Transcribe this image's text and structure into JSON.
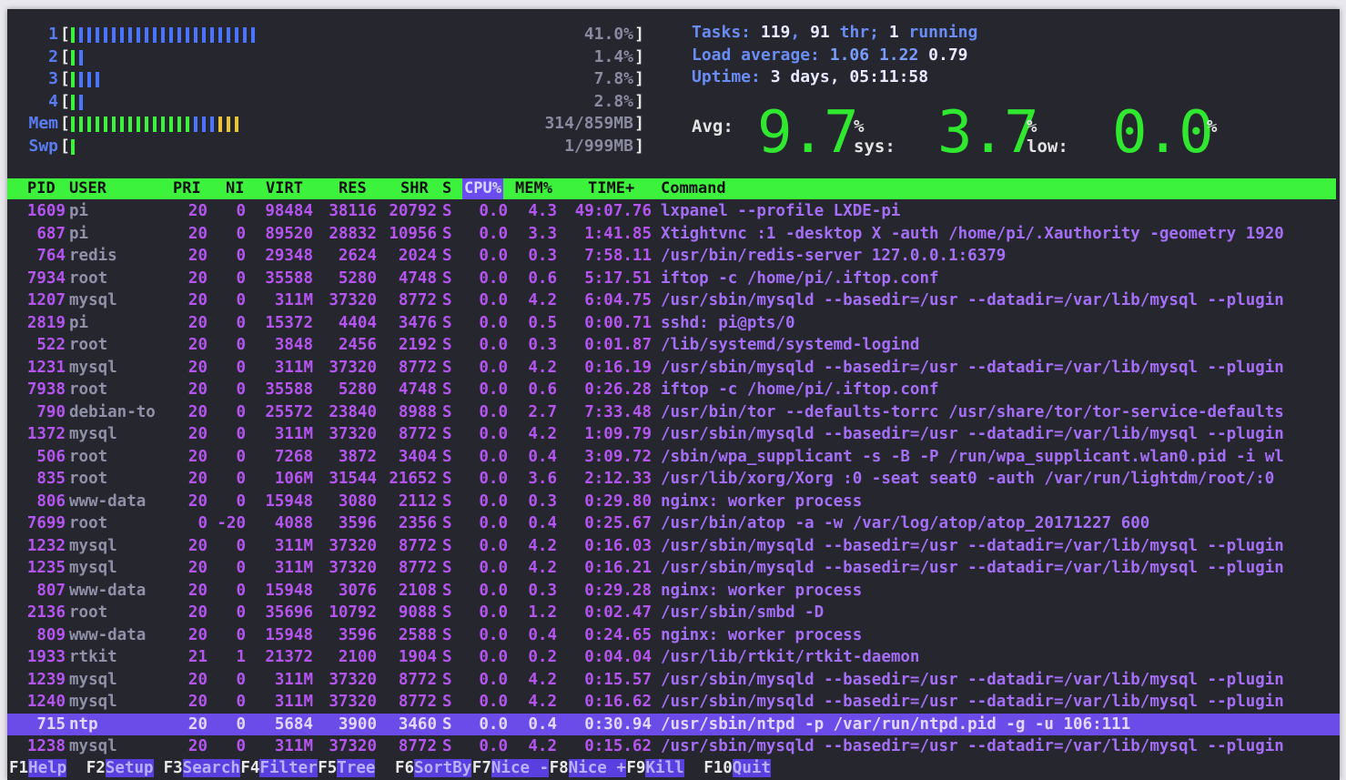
{
  "colors": {
    "terminal_bg": "#26262e",
    "header_bar": "#3df23d",
    "sorted_column": "#6a4cf0",
    "selected_row": "#6b4ce8",
    "process_text": "#b455f0",
    "meter_green": "#3df23d",
    "meter_blue": "#4a74ff",
    "meter_yellow": "#e8c43a"
  },
  "meters": {
    "cpu": [
      {
        "label": "1",
        "value": "41.0%",
        "percent": 0.41
      },
      {
        "label": "2",
        "value": "1.4%",
        "percent": 0.014
      },
      {
        "label": "3",
        "value": "7.8%",
        "percent": 0.078
      },
      {
        "label": "4",
        "value": "2.8%",
        "percent": 0.028
      }
    ],
    "mem": {
      "label": "Mem",
      "value": "314/859MB",
      "percent": 0.366
    },
    "swp": {
      "label": "Swp",
      "value": "1/999MB",
      "percent": 0.001
    }
  },
  "info": {
    "tasks_label": "Tasks:",
    "tasks_count": "119",
    "threads_count": "91",
    "threads_label": "thr;",
    "running_count": "1",
    "running_label": "running",
    "load_label": "Load average:",
    "load_1": "1.06",
    "load_5": "1.22",
    "load_15": "0.79",
    "uptime_label": "Uptime:",
    "uptime_value": "3 days, 05:11:58"
  },
  "avg_meter": {
    "avg_label": "Avg:",
    "avg_value": "9.7",
    "sys_label": "% sys:",
    "sys_value": "3.7",
    "low_label": "% low:",
    "low_value": "0.0",
    "end_label": "%"
  },
  "columns": [
    "PID",
    "USER",
    "PRI",
    "NI",
    "VIRT",
    "RES",
    "SHR",
    "S",
    "CPU%",
    "MEM%",
    "TIME+",
    "Command"
  ],
  "processes": [
    {
      "pid": "1609",
      "user": "pi",
      "pri": "20",
      "ni": "0",
      "virt": "98484",
      "res": "38116",
      "shr": "20792",
      "s": "S",
      "cpu": "0.0",
      "mem": "4.3",
      "time": "49:07.76",
      "cmd": "lxpanel --profile LXDE-pi"
    },
    {
      "pid": "687",
      "user": "pi",
      "pri": "20",
      "ni": "0",
      "virt": "89520",
      "res": "28832",
      "shr": "10956",
      "s": "S",
      "cpu": "0.0",
      "mem": "3.3",
      "time": "1:41.85",
      "cmd": "Xtightvnc :1 -desktop X -auth /home/pi/.Xauthority -geometry 1920"
    },
    {
      "pid": "764",
      "user": "redis",
      "pri": "20",
      "ni": "0",
      "virt": "29348",
      "res": "2624",
      "shr": "2024",
      "s": "S",
      "cpu": "0.0",
      "mem": "0.3",
      "time": "7:58.11",
      "cmd": "/usr/bin/redis-server 127.0.0.1:6379"
    },
    {
      "pid": "7934",
      "user": "root",
      "pri": "20",
      "ni": "0",
      "virt": "35588",
      "res": "5280",
      "shr": "4748",
      "s": "S",
      "cpu": "0.0",
      "mem": "0.6",
      "time": "5:17.51",
      "cmd": "iftop -c /home/pi/.iftop.conf"
    },
    {
      "pid": "1207",
      "user": "mysql",
      "pri": "20",
      "ni": "0",
      "virt": "311M",
      "res": "37320",
      "shr": "8772",
      "s": "S",
      "cpu": "0.0",
      "mem": "4.2",
      "time": "6:04.75",
      "cmd": "/usr/sbin/mysqld --basedir=/usr --datadir=/var/lib/mysql --plugin"
    },
    {
      "pid": "2819",
      "user": "pi",
      "pri": "20",
      "ni": "0",
      "virt": "15372",
      "res": "4404",
      "shr": "3476",
      "s": "S",
      "cpu": "0.0",
      "mem": "0.5",
      "time": "0:00.71",
      "cmd": "sshd: pi@pts/0"
    },
    {
      "pid": "522",
      "user": "root",
      "pri": "20",
      "ni": "0",
      "virt": "3848",
      "res": "2456",
      "shr": "2192",
      "s": "S",
      "cpu": "0.0",
      "mem": "0.3",
      "time": "0:01.87",
      "cmd": "/lib/systemd/systemd-logind"
    },
    {
      "pid": "1231",
      "user": "mysql",
      "pri": "20",
      "ni": "0",
      "virt": "311M",
      "res": "37320",
      "shr": "8772",
      "s": "S",
      "cpu": "0.0",
      "mem": "4.2",
      "time": "0:16.19",
      "cmd": "/usr/sbin/mysqld --basedir=/usr --datadir=/var/lib/mysql --plugin"
    },
    {
      "pid": "7938",
      "user": "root",
      "pri": "20",
      "ni": "0",
      "virt": "35588",
      "res": "5280",
      "shr": "4748",
      "s": "S",
      "cpu": "0.0",
      "mem": "0.6",
      "time": "0:26.28",
      "cmd": "iftop -c /home/pi/.iftop.conf"
    },
    {
      "pid": "790",
      "user": "debian-to",
      "pri": "20",
      "ni": "0",
      "virt": "25572",
      "res": "23840",
      "shr": "8988",
      "s": "S",
      "cpu": "0.0",
      "mem": "2.7",
      "time": "7:33.48",
      "cmd": "/usr/bin/tor --defaults-torrc /usr/share/tor/tor-service-defaults"
    },
    {
      "pid": "1372",
      "user": "mysql",
      "pri": "20",
      "ni": "0",
      "virt": "311M",
      "res": "37320",
      "shr": "8772",
      "s": "S",
      "cpu": "0.0",
      "mem": "4.2",
      "time": "1:09.79",
      "cmd": "/usr/sbin/mysqld --basedir=/usr --datadir=/var/lib/mysql --plugin"
    },
    {
      "pid": "506",
      "user": "root",
      "pri": "20",
      "ni": "0",
      "virt": "7268",
      "res": "3872",
      "shr": "3404",
      "s": "S",
      "cpu": "0.0",
      "mem": "0.4",
      "time": "3:09.72",
      "cmd": "/sbin/wpa_supplicant -s -B -P /run/wpa_supplicant.wlan0.pid -i wl"
    },
    {
      "pid": "835",
      "user": "root",
      "pri": "20",
      "ni": "0",
      "virt": "106M",
      "res": "31544",
      "shr": "21652",
      "s": "S",
      "cpu": "0.0",
      "mem": "3.6",
      "time": "2:12.33",
      "cmd": "/usr/lib/xorg/Xorg :0 -seat seat0 -auth /var/run/lightdm/root/:0"
    },
    {
      "pid": "806",
      "user": "www-data",
      "pri": "20",
      "ni": "0",
      "virt": "15948",
      "res": "3080",
      "shr": "2112",
      "s": "S",
      "cpu": "0.0",
      "mem": "0.3",
      "time": "0:29.80",
      "cmd": "nginx: worker process"
    },
    {
      "pid": "7699",
      "user": "root",
      "pri": "0",
      "ni": "-20",
      "virt": "4088",
      "res": "3596",
      "shr": "2356",
      "s": "S",
      "cpu": "0.0",
      "mem": "0.4",
      "time": "0:25.67",
      "cmd": "/usr/bin/atop -a -w /var/log/atop/atop_20171227 600"
    },
    {
      "pid": "1232",
      "user": "mysql",
      "pri": "20",
      "ni": "0",
      "virt": "311M",
      "res": "37320",
      "shr": "8772",
      "s": "S",
      "cpu": "0.0",
      "mem": "4.2",
      "time": "0:16.03",
      "cmd": "/usr/sbin/mysqld --basedir=/usr --datadir=/var/lib/mysql --plugin"
    },
    {
      "pid": "1235",
      "user": "mysql",
      "pri": "20",
      "ni": "0",
      "virt": "311M",
      "res": "37320",
      "shr": "8772",
      "s": "S",
      "cpu": "0.0",
      "mem": "4.2",
      "time": "0:16.21",
      "cmd": "/usr/sbin/mysqld --basedir=/usr --datadir=/var/lib/mysql --plugin"
    },
    {
      "pid": "807",
      "user": "www-data",
      "pri": "20",
      "ni": "0",
      "virt": "15948",
      "res": "3076",
      "shr": "2108",
      "s": "S",
      "cpu": "0.0",
      "mem": "0.3",
      "time": "0:29.28",
      "cmd": "nginx: worker process"
    },
    {
      "pid": "2136",
      "user": "root",
      "pri": "20",
      "ni": "0",
      "virt": "35696",
      "res": "10792",
      "shr": "9088",
      "s": "S",
      "cpu": "0.0",
      "mem": "1.2",
      "time": "0:02.47",
      "cmd": "/usr/sbin/smbd -D"
    },
    {
      "pid": "809",
      "user": "www-data",
      "pri": "20",
      "ni": "0",
      "virt": "15948",
      "res": "3596",
      "shr": "2588",
      "s": "S",
      "cpu": "0.0",
      "mem": "0.4",
      "time": "0:24.65",
      "cmd": "nginx: worker process"
    },
    {
      "pid": "1933",
      "user": "rtkit",
      "pri": "21",
      "ni": "1",
      "virt": "21372",
      "res": "2100",
      "shr": "1904",
      "s": "S",
      "cpu": "0.0",
      "mem": "0.2",
      "time": "0:04.04",
      "cmd": "/usr/lib/rtkit/rtkit-daemon"
    },
    {
      "pid": "1239",
      "user": "mysql",
      "pri": "20",
      "ni": "0",
      "virt": "311M",
      "res": "37320",
      "shr": "8772",
      "s": "S",
      "cpu": "0.0",
      "mem": "4.2",
      "time": "0:15.57",
      "cmd": "/usr/sbin/mysqld --basedir=/usr --datadir=/var/lib/mysql --plugin"
    },
    {
      "pid": "1240",
      "user": "mysql",
      "pri": "20",
      "ni": "0",
      "virt": "311M",
      "res": "37320",
      "shr": "8772",
      "s": "S",
      "cpu": "0.0",
      "mem": "4.2",
      "time": "0:16.62",
      "cmd": "/usr/sbin/mysqld --basedir=/usr --datadir=/var/lib/mysql --plugin"
    },
    {
      "pid": "715",
      "user": "ntp",
      "pri": "20",
      "ni": "0",
      "virt": "5684",
      "res": "3900",
      "shr": "3460",
      "s": "S",
      "cpu": "0.0",
      "mem": "0.4",
      "time": "0:30.94",
      "cmd": "/usr/sbin/ntpd -p /var/run/ntpd.pid -g -u 106:111",
      "selected": true
    },
    {
      "pid": "1238",
      "user": "mysql",
      "pri": "20",
      "ni": "0",
      "virt": "311M",
      "res": "37320",
      "shr": "8772",
      "s": "S",
      "cpu": "0.0",
      "mem": "4.2",
      "time": "0:15.62",
      "cmd": "/usr/sbin/mysqld --basedir=/usr --datadir=/var/lib/mysql --plugin"
    }
  ],
  "function_keys": [
    {
      "key": "F1",
      "label": "Help"
    },
    {
      "key": "F2",
      "label": "Setup"
    },
    {
      "key": "F3",
      "label": "Search"
    },
    {
      "key": "F4",
      "label": "Filter"
    },
    {
      "key": "F5",
      "label": "Tree"
    },
    {
      "key": "F6",
      "label": "SortBy"
    },
    {
      "key": "F7",
      "label": "Nice -"
    },
    {
      "key": "F8",
      "label": "Nice +"
    },
    {
      "key": "F9",
      "label": "Kill"
    },
    {
      "key": "F10",
      "label": "Quit"
    }
  ]
}
